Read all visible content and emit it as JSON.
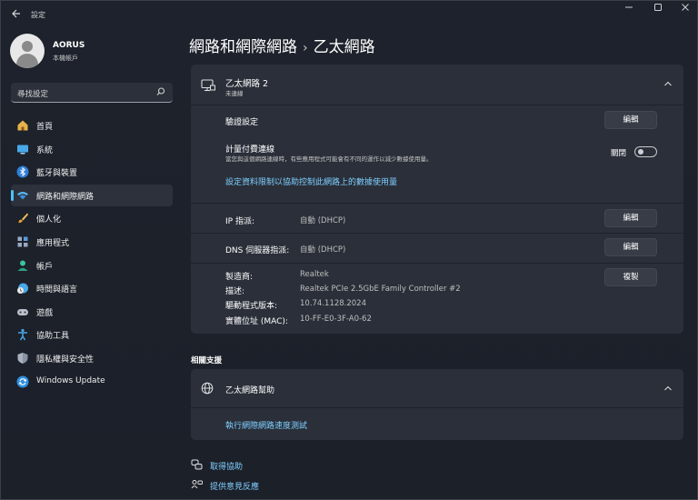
{
  "window": {
    "app_title": "設定",
    "back_icon": "back-arrow-icon",
    "controls": [
      "minimize-icon",
      "maximize-icon",
      "close-icon"
    ]
  },
  "profile": {
    "name": "AORUS",
    "subtitle": "本機帳戶"
  },
  "search": {
    "placeholder": "尋找設定"
  },
  "nav": {
    "items": [
      {
        "label": "首頁",
        "icon": "home-icon"
      },
      {
        "label": "系統",
        "icon": "system-icon"
      },
      {
        "label": "藍牙與裝置",
        "icon": "bluetooth-icon"
      },
      {
        "label": "網路和網際網路",
        "icon": "network-icon"
      },
      {
        "label": "個人化",
        "icon": "brush-icon"
      },
      {
        "label": "應用程式",
        "icon": "apps-icon"
      },
      {
        "label": "帳戶",
        "icon": "account-icon"
      },
      {
        "label": "時間與語言",
        "icon": "time-language-icon"
      },
      {
        "label": "遊戲",
        "icon": "gaming-icon"
      },
      {
        "label": "協助工具",
        "icon": "accessibility-icon"
      },
      {
        "label": "隱私權與安全性",
        "icon": "shield-icon"
      },
      {
        "label": "Windows Update",
        "icon": "update-icon"
      }
    ],
    "active_index": 3
  },
  "breadcrumb": {
    "parent": "網路和網際網路",
    "separator": "›",
    "current": "乙太網路"
  },
  "adapter": {
    "title": "乙太網路 2",
    "status": "未連線",
    "auth_label": "驗證設定",
    "auth_button": "編輯",
    "metered_label": "計量付費連線",
    "metered_desc": "當您與這個網路連線時，有些應用程式可能會有不同的運作以減少數據使用量。",
    "metered_state": "關閉",
    "metered_on": false,
    "data_limit_link": "設定資料限制以協助控制此網路上的數據使用量",
    "ip_label": "IP 指派:",
    "ip_value": "自動 (DHCP)",
    "ip_button": "編輯",
    "dns_label": "DNS 伺服器指派:",
    "dns_value": "自動 (DHCP)",
    "dns_button": "編輯",
    "props": [
      {
        "label": "製造商:",
        "value": "Realtek"
      },
      {
        "label": "描述:",
        "value": "Realtek PCIe 2.5GbE Family Controller #2"
      },
      {
        "label": "驅動程式版本:",
        "value": "10.74.1128.2024"
      },
      {
        "label": "實體位址 (MAC):",
        "value": "10-FF-E0-3F-A0-62"
      }
    ],
    "copy_button": "複製"
  },
  "support": {
    "section_title": "相關支援",
    "help_title": "乙太網路幫助",
    "help_link": "執行網際網路速度測試"
  },
  "footer": {
    "get_help": "取得協助",
    "feedback": "提供意見反應"
  },
  "colors": {
    "accent": "#4cc2ff",
    "link": "#7fcfff",
    "card": "#2a2f39",
    "background": "#1d222c"
  }
}
